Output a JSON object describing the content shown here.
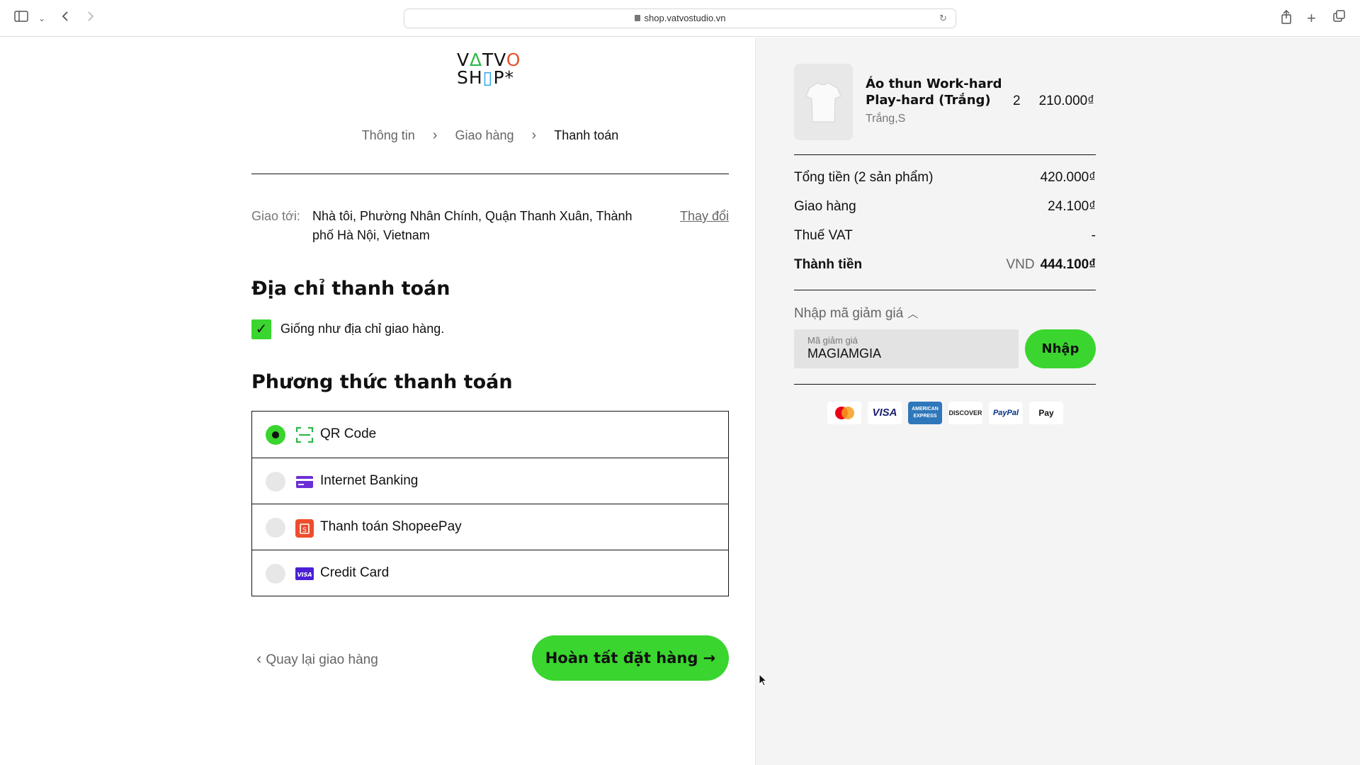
{
  "browser": {
    "url": "shop.vatvostudio.vn"
  },
  "logo": {
    "line1": "VATVO",
    "line2": "SHOP*"
  },
  "breadcrumb": {
    "step1": "Thông tin",
    "step2": "Giao hàng",
    "step3": "Thanh toán"
  },
  "shipping": {
    "label": "Giao tới:",
    "address": "Nhà tôi, Phường Nhân Chính, Quận Thanh Xuân, Thành phố Hà Nội, Vietnam",
    "change": "Thay đổi"
  },
  "billing": {
    "title": "Địa chỉ thanh toán",
    "same_as_shipping": "Giống như địa chỉ giao hàng.",
    "checked": true
  },
  "payment": {
    "title": "Phương thức thanh toán",
    "methods": [
      {
        "label": "QR Code",
        "selected": true,
        "icon": "qr-scan-icon"
      },
      {
        "label": "Internet Banking",
        "selected": false,
        "icon": "bank-card-icon"
      },
      {
        "label": "Thanh toán ShopeePay",
        "selected": false,
        "icon": "shopeepay-icon"
      },
      {
        "label": "Credit Card",
        "selected": false,
        "icon": "visa-card-icon"
      }
    ]
  },
  "actions": {
    "back": "Quay lại giao hàng",
    "finish": "Hoàn tất đặt hàng →"
  },
  "cart": {
    "item": {
      "name": "Áo thun Work-hard Play-hard (Trắng)",
      "variant": "Trắng,S",
      "qty": "2",
      "price": "210.000₫"
    },
    "subtotal_label": "Tổng tiền (2 sản phẩm)",
    "subtotal": "420.000₫",
    "shipping_label": "Giao hàng",
    "shipping": "24.100₫",
    "vat_label": "Thuế VAT",
    "vat": "-",
    "total_label": "Thành tiền",
    "currency": "VND",
    "total": "444.100₫"
  },
  "discount": {
    "toggle": "Nhập mã giảm giá",
    "field_label": "Mã giảm giá",
    "value": "MAGIAMGIA",
    "apply": "Nhập"
  },
  "payment_logos": [
    {
      "name": "mastercard",
      "text": ""
    },
    {
      "name": "visa",
      "text": "VISA"
    },
    {
      "name": "amex",
      "text": "AMERICAN EXPRESS"
    },
    {
      "name": "discover",
      "text": "DISCOVER"
    },
    {
      "name": "paypal",
      "text": "PayPal"
    },
    {
      "name": "applepay",
      "text": "Pay"
    }
  ],
  "colors": {
    "accent_green": "#3ad52e",
    "right_panel_bg": "#f4f4f4"
  }
}
